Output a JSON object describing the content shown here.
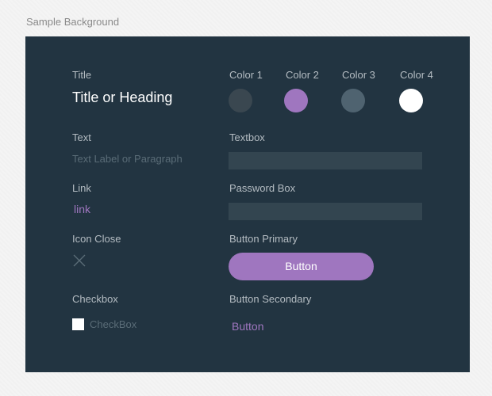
{
  "background_label": "Sample Background",
  "colors": {
    "panel_bg": "#223441",
    "accent": "#9f76bf",
    "field_bg": "#334550"
  },
  "title_section": {
    "label": "Title",
    "heading": "Title or Heading"
  },
  "swatches": [
    {
      "label": "Color 1",
      "color": "#3a4750"
    },
    {
      "label": "Color 2",
      "color": "#9f76bf"
    },
    {
      "label": "Color 3",
      "color": "#4f6370"
    },
    {
      "label": "Color 4",
      "color": "#ffffff"
    }
  ],
  "text_section": {
    "label": "Text",
    "content": "Text Label or Paragraph"
  },
  "textbox": {
    "label": "Textbox",
    "value": ""
  },
  "link_section": {
    "label": "Link",
    "text": "link"
  },
  "password": {
    "label": "Password Box",
    "value": ""
  },
  "icon_close": {
    "label": "Icon Close",
    "icon": "close-icon"
  },
  "button_primary": {
    "label": "Button Primary",
    "text": "Button"
  },
  "checkbox": {
    "label": "Checkbox",
    "text": "CheckBox",
    "checked": false
  },
  "button_secondary": {
    "label": "Button Secondary",
    "text": "Button"
  }
}
